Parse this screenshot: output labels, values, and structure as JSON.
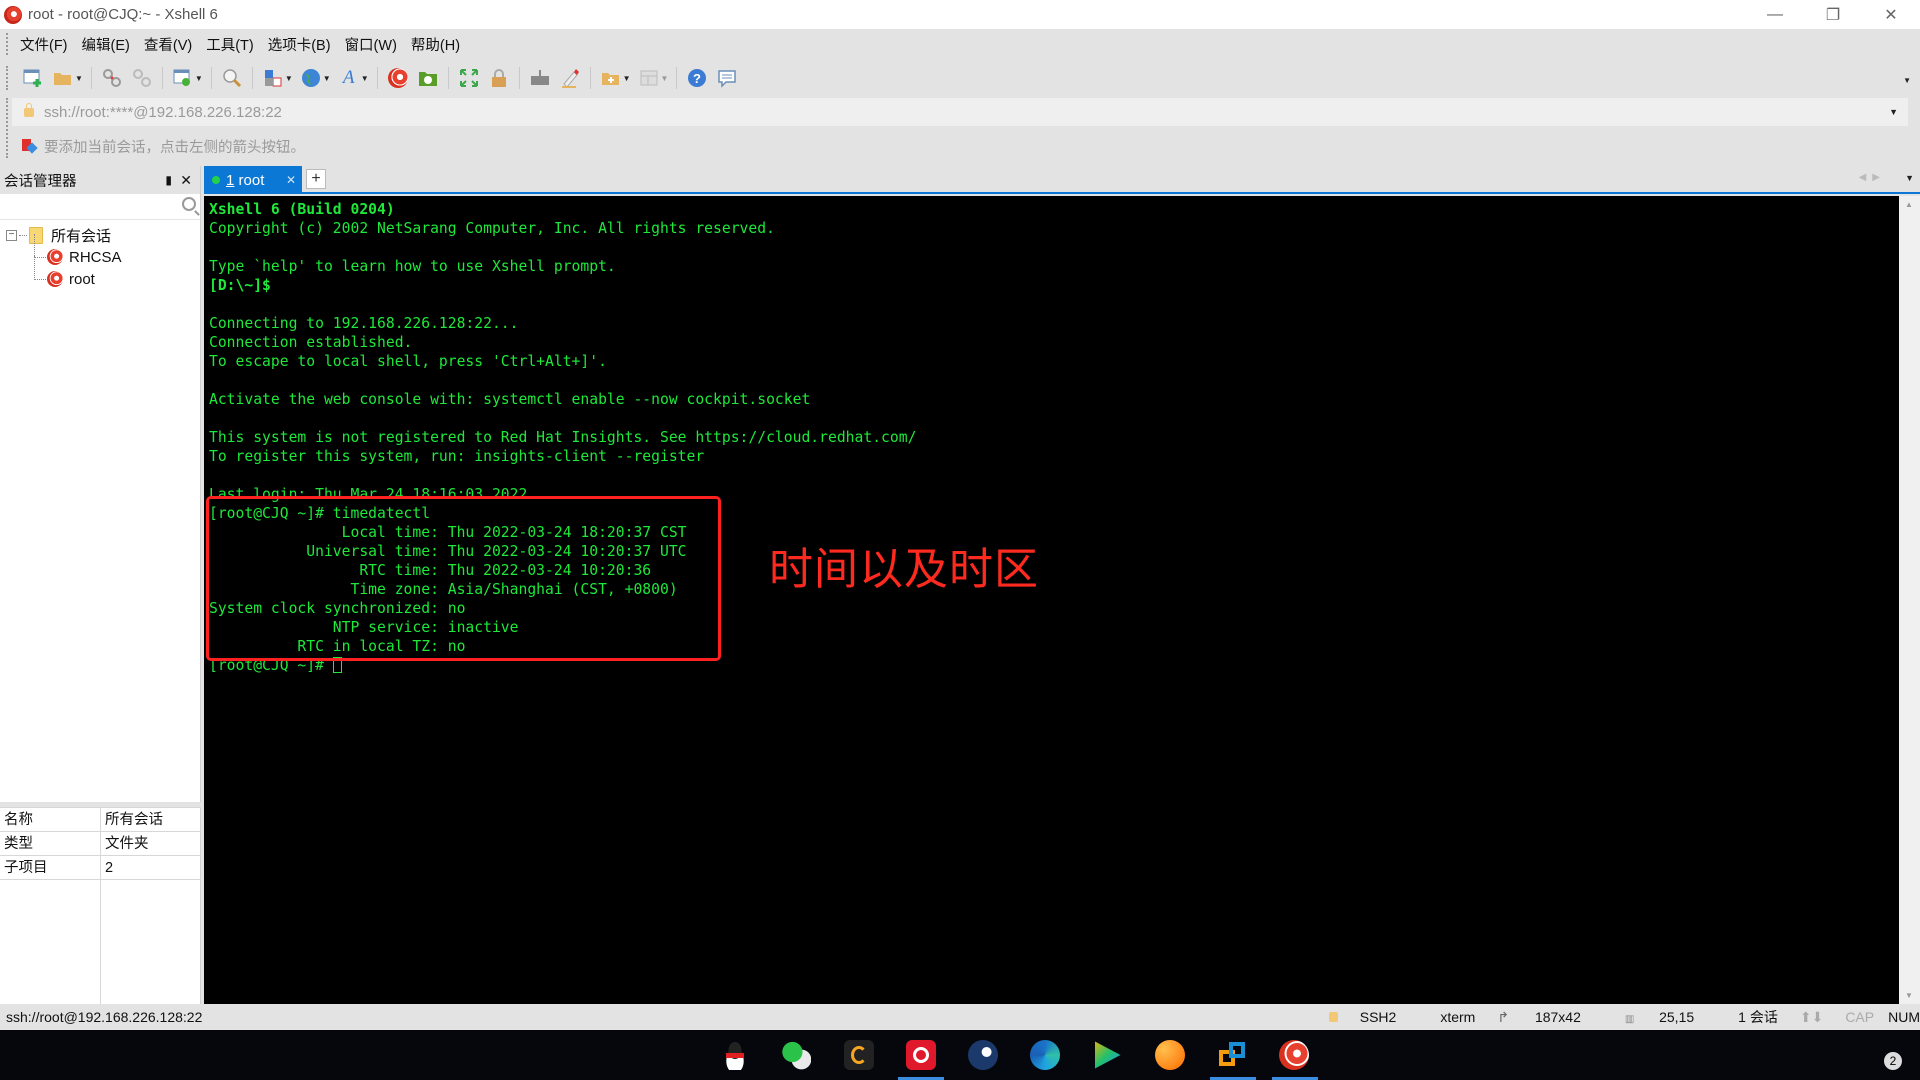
{
  "window": {
    "title": "root - root@CJQ:~ - Xshell 6",
    "controls": {
      "minimize": "—",
      "restore": "❐",
      "close": "✕"
    }
  },
  "menu": [
    "文件(F)",
    "编辑(E)",
    "查看(V)",
    "工具(T)",
    "选项卡(B)",
    "窗口(W)",
    "帮助(H)"
  ],
  "toolbar": {
    "icons": [
      "new-session-icon",
      "open-folder-icon",
      "disconnect-icon",
      "reconnect-icon",
      "session-properties-icon",
      "find-icon",
      "transfer-icon",
      "globe-icon",
      "font-icon",
      "xshell-icon",
      "xftp-icon",
      "fullscreen-icon",
      "lock-icon",
      "keyboard-icon",
      "highlight-pen-icon",
      "new-folder-icon",
      "layout-icon",
      "help-icon",
      "chat-icon"
    ]
  },
  "address": {
    "value": "ssh://root:****@192.168.226.128:22"
  },
  "hint": {
    "text": "要添加当前会话，点击左侧的箭头按钮。"
  },
  "session_manager": {
    "title": "会话管理器",
    "search_placeholder": "",
    "tree": {
      "root_label": "所有会话",
      "children": [
        "RHCSA",
        "root"
      ]
    },
    "properties": [
      {
        "key": "名称",
        "value": "所有会话"
      },
      {
        "key": "类型",
        "value": "文件夹"
      },
      {
        "key": "子项目",
        "value": "2"
      }
    ]
  },
  "tabs": [
    {
      "index": "1",
      "label": "root",
      "active": true
    }
  ],
  "terminal": {
    "lines": [
      {
        "text": "Xshell 6 (Build 0204)",
        "bold": true
      },
      {
        "text": "Copyright (c) 2002 NetSarang Computer, Inc. All rights reserved."
      },
      {
        "text": ""
      },
      {
        "text": "Type `help' to learn how to use Xshell prompt."
      },
      {
        "text": "[D:\\~]$",
        "bold": true
      },
      {
        "text": ""
      },
      {
        "text": "Connecting to 192.168.226.128:22..."
      },
      {
        "text": "Connection established."
      },
      {
        "text": "To escape to local shell, press 'Ctrl+Alt+]'."
      },
      {
        "text": ""
      },
      {
        "text": "Activate the web console with: systemctl enable --now cockpit.socket"
      },
      {
        "text": ""
      },
      {
        "text": "This system is not registered to Red Hat Insights. See https://cloud.redhat.com/"
      },
      {
        "text": "To register this system, run: insights-client --register"
      },
      {
        "text": ""
      },
      {
        "text": "Last login: Thu Mar 24 18:16:03 2022"
      },
      {
        "text": "[root@CJQ ~]# timedatectl"
      },
      {
        "text": "               Local time: Thu 2022-03-24 18:20:37 CST"
      },
      {
        "text": "           Universal time: Thu 2022-03-24 10:20:37 UTC"
      },
      {
        "text": "                 RTC time: Thu 2022-03-24 10:20:36"
      },
      {
        "text": "                Time zone: Asia/Shanghai (CST, +0800)"
      },
      {
        "text": "System clock synchronized: no"
      },
      {
        "text": "              NTP service: inactive"
      },
      {
        "text": "          RTC in local TZ: no"
      }
    ],
    "prompt": "[root@CJQ ~]# ",
    "text_color": "#1ee83a"
  },
  "annotation": {
    "text": "时间以及时区",
    "color": "#ff2a1f"
  },
  "statusbar": {
    "connection": "ssh://root@192.168.226.128:22",
    "protocol": "SSH2",
    "terminal_type": "xterm",
    "size": "187x42",
    "cursor_pos": "25,15",
    "sessions": "1 会话",
    "cap": "CAP",
    "num": "NUM"
  },
  "taskbar": {
    "apps": [
      "QQ",
      "WeChat",
      "GameViewer",
      "NetEase Cloud Music",
      "Steam",
      "Microsoft Edge",
      "Tencent Video",
      "Lingxi",
      "VMware Workstation",
      "Xshell"
    ],
    "notification_count": "2"
  },
  "colors": {
    "accent": "#0a78d4",
    "terminal_bg": "#000000",
    "highlight_box": "#ff2020"
  }
}
